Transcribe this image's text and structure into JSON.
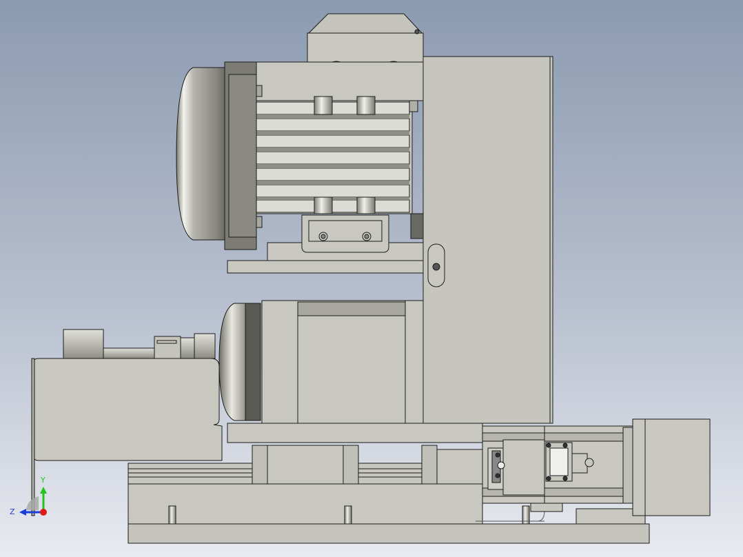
{
  "viewport": {
    "background_top": "#8f9db3",
    "background_bottom": "#e6e8ee",
    "part_fill": "#c8c8c0",
    "part_dark": "#8e8e86",
    "edge_color": "#1a1a1a"
  },
  "triad": {
    "x_label": "",
    "y_label": "Y",
    "z_label": "Z",
    "y_color": "#1fc41f",
    "z_color": "#1a3cd8",
    "origin_color": "#e01a1a"
  },
  "icons": {
    "model": "cad-assembly-icon",
    "triad": "coordinate-triad-icon"
  }
}
